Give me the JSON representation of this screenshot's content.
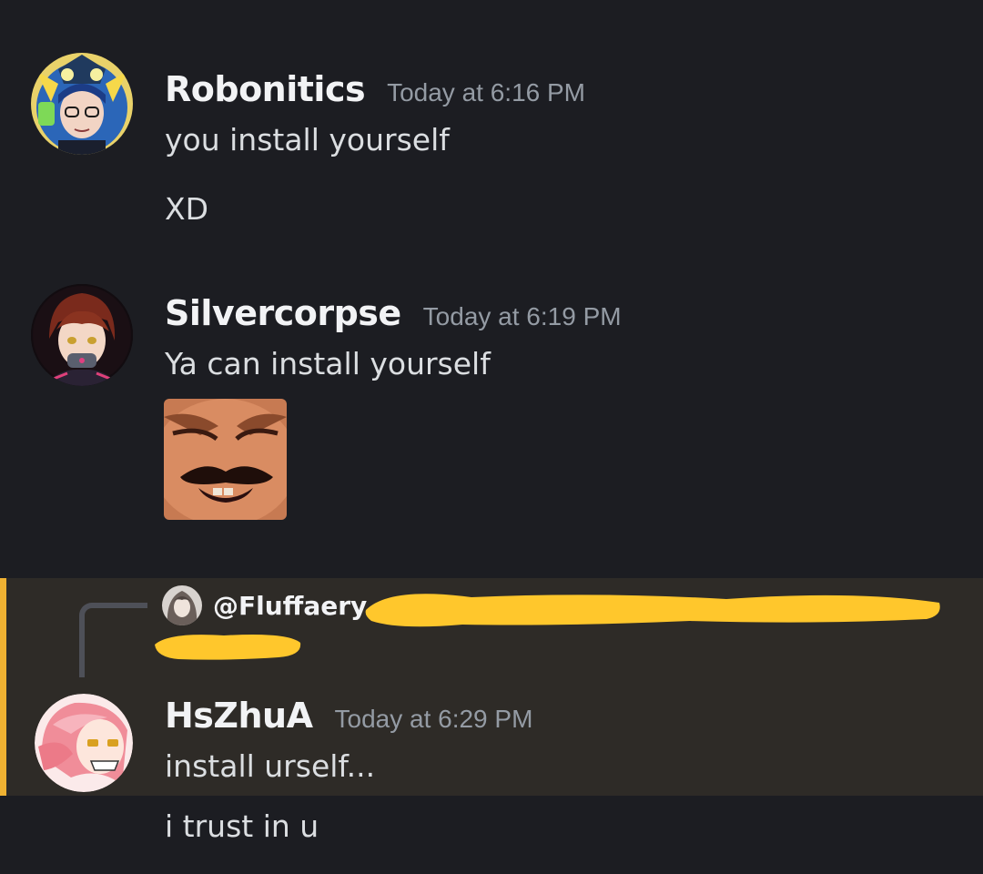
{
  "messages": [
    {
      "username": "Robonitics",
      "timestamp": "Today at 6:16 PM",
      "lines": [
        "you install yourself",
        "XD"
      ]
    },
    {
      "username": "Silvercorpse",
      "timestamp": "Today at 6:19 PM",
      "lines": [
        "Ya can install yourself"
      ],
      "attachment": "laughing-man-emoji"
    },
    {
      "reply_to": "@Fluffaery",
      "username": "HsZhuA",
      "timestamp": "Today at 6:29 PM",
      "lines": [
        "install urself...",
        "i trust in u"
      ],
      "highlight_color": "#f0b232"
    }
  ],
  "colors": {
    "background": "#1c1d22",
    "highlight_background": "#2e2b27",
    "mention_bar": "#f0b232",
    "redaction": "#ffc72c"
  }
}
